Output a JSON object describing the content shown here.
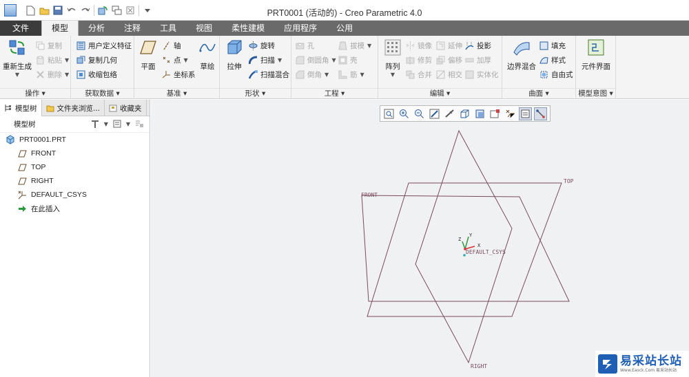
{
  "window": {
    "title": "PRT0001 (活动的) - Creo Parametric 4.0"
  },
  "quick_access": {
    "icons": [
      "new-icon",
      "open-icon",
      "save-icon",
      "undo-icon",
      "redo-icon",
      "regenerate-icon",
      "windows-icon",
      "close-icon",
      "customize-icon"
    ]
  },
  "tabs": [
    "文件",
    "模型",
    "分析",
    "注释",
    "工具",
    "视图",
    "柔性建模",
    "应用程序",
    "公用"
  ],
  "active_tab": "模型",
  "ribbon": {
    "operations": {
      "label": "操作 ▾",
      "regenerate": "重新生成",
      "copy": "复制",
      "paste": "粘贴",
      "delete": "删除"
    },
    "get_data": {
      "label": "获取数据 ▾",
      "udf": "用户定义特征",
      "copy_geom": "复制几何",
      "shrinkwrap": "收缩包络"
    },
    "datum": {
      "label": "基准 ▾",
      "plane": "平面",
      "axis": "轴",
      "point": "点",
      "csys": "坐标系",
      "sketch": "草绘"
    },
    "shapes": {
      "label": "形状 ▾",
      "extrude": "拉伸",
      "revolve": "旋转",
      "sweep": "扫描",
      "swept_blend": "扫描混合"
    },
    "engineering": {
      "label": "工程 ▾",
      "hole": "孔",
      "round": "倒圆角",
      "chamfer": "倒角",
      "draft": "拔模",
      "shell": "壳",
      "rib": "筋"
    },
    "editing": {
      "label": "编辑 ▾",
      "pattern": "阵列",
      "mirror": "镜像",
      "extend": "延伸",
      "project": "投影",
      "trim": "修剪",
      "offset": "偏移",
      "thicken": "加厚",
      "merge": "合并",
      "intersect": "相交",
      "solidify": "实体化"
    },
    "surfaces": {
      "label": "曲面 ▾",
      "boundary_blend": "边界混合",
      "fill": "填充",
      "style": "样式",
      "freestyle": "自由式"
    },
    "model_intent": {
      "label": "模型意图 ▾",
      "component_interface": "元件界面"
    }
  },
  "left_panel": {
    "tabs": [
      "模型树",
      "文件夹浏览...",
      "收藏夹"
    ],
    "header": "模型树",
    "tree": {
      "root": "PRT0001.PRT",
      "items": [
        {
          "label": "FRONT",
          "icon": "datum-plane-icon"
        },
        {
          "label": "TOP",
          "icon": "datum-plane-icon"
        },
        {
          "label": "RIGHT",
          "icon": "datum-plane-icon"
        },
        {
          "label": "DEFAULT_CSYS",
          "icon": "csys-icon"
        },
        {
          "label": "在此插入",
          "icon": "insert-arrow-icon"
        }
      ]
    }
  },
  "graphics": {
    "labels": {
      "front": "FRONT",
      "top": "TOP",
      "right": "RIGHT",
      "csys": "DEFAULT_CSYS",
      "axis_x": "X",
      "axis_y": "Y",
      "axis_z": "Z"
    },
    "view_toolbar_icons": [
      "refit-icon",
      "zoom-in-icon",
      "zoom-out-icon",
      "repaint-icon",
      "reorient-icon",
      "saved-views-icon",
      "display-style-icon",
      "perspective-icon",
      "datum-display-icon",
      "spin-center-icon",
      "annotation-icon"
    ]
  },
  "watermark": {
    "text": "易采站长站",
    "sub": "Www.Easck.Com  易采站长站"
  },
  "colors": {
    "datum_lines": "#7a4a5a",
    "tab_bar": "#6a6a6a",
    "background": "#f0f1f3"
  }
}
